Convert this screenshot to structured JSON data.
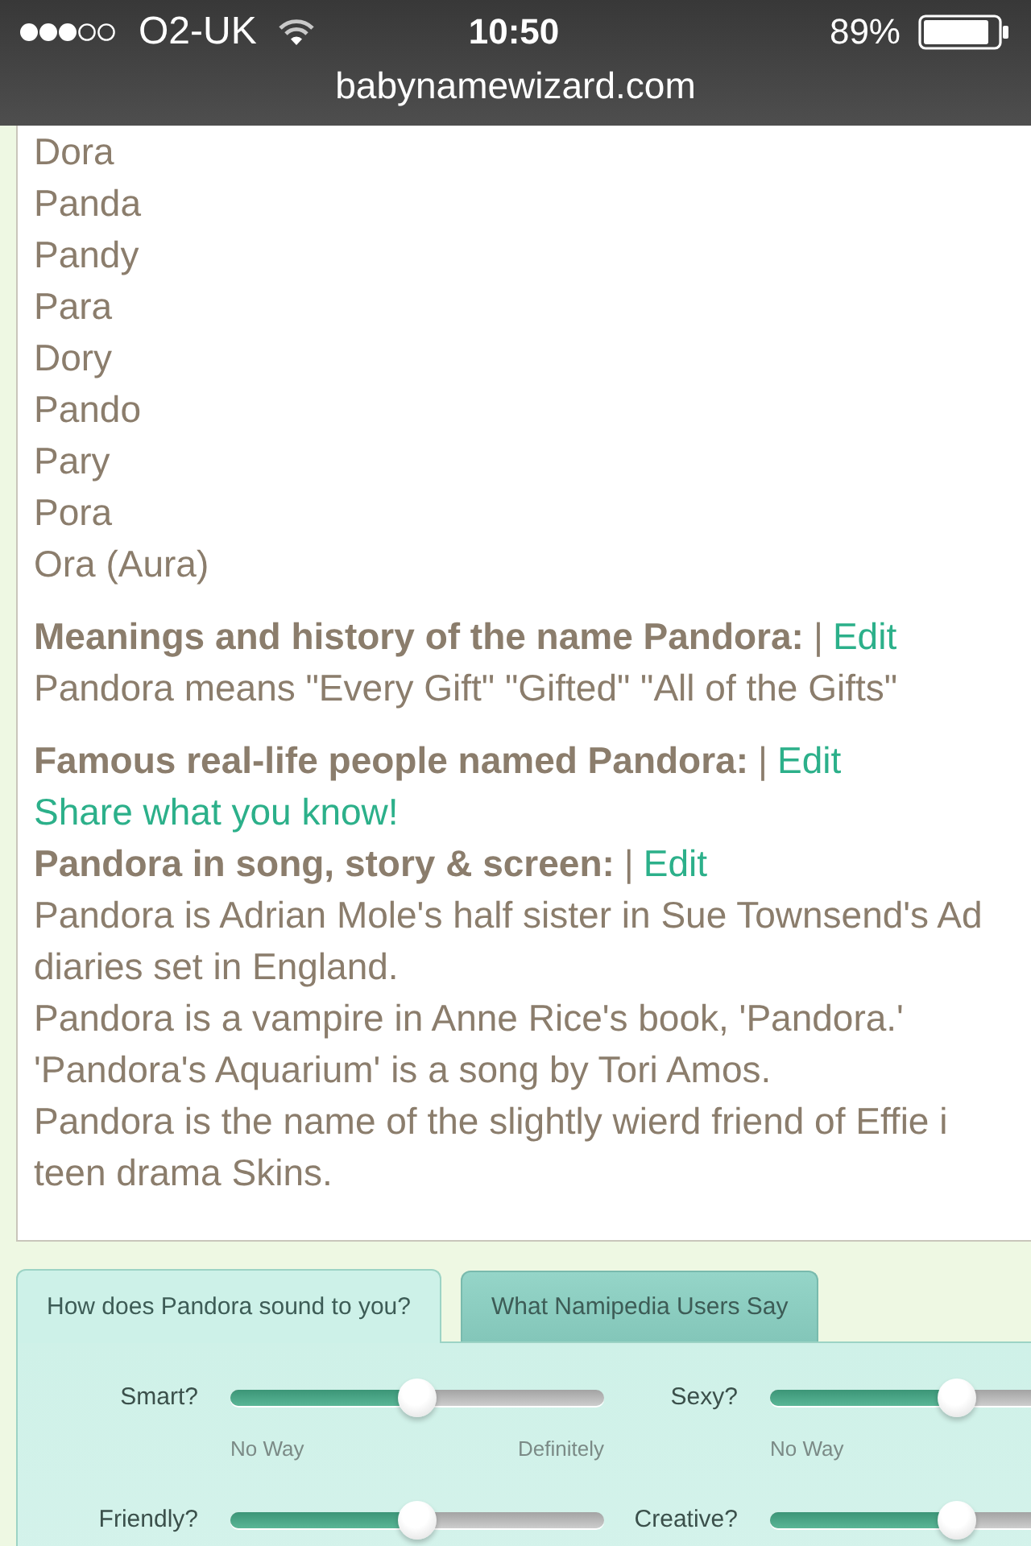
{
  "status_bar": {
    "carrier": "O2-UK",
    "time": "10:50",
    "battery": "89%",
    "url": "babynamewizard.com"
  },
  "nicknames": [
    "Dora",
    "Panda",
    "Pandy",
    "Para",
    "Dory",
    "Pando",
    "Pary",
    "Pora",
    "Ora (Aura)"
  ],
  "groups": [
    {
      "sections": [
        {
          "heading": "Meanings and history of the name Pandora:",
          "separator": "|",
          "link": "Edit",
          "body": [
            {
              "kind": "text",
              "lines": [
                "Pandora means \"Every Gift\" \"Gifted\" \"All of the Gifts\""
              ]
            }
          ]
        }
      ]
    },
    {
      "sections": [
        {
          "heading": "Famous real-life people named Pandora:",
          "separator": "|",
          "link": "Edit",
          "body": [
            {
              "kind": "link",
              "lines": [
                "Share what you know!"
              ]
            }
          ]
        },
        {
          "heading": "Pandora in song, story & screen:",
          "separator": "|",
          "link": "Edit",
          "body": [
            {
              "kind": "text",
              "lines": [
                "Pandora is Adrian Mole's half sister in Sue Townsend's Ad",
                "diaries set in England."
              ]
            },
            {
              "kind": "text",
              "lines": [
                "Pandora is a vampire in Anne Rice's book, 'Pandora.'"
              ]
            },
            {
              "kind": "text",
              "lines": [
                "'Pandora's Aquarium' is a song by Tori Amos."
              ]
            },
            {
              "kind": "text",
              "lines": [
                "Pandora is the name of the slightly wierd friend of Effie i",
                "teen drama Skins."
              ]
            }
          ]
        }
      ]
    }
  ],
  "rating_tabs": [
    {
      "label": "How does Pandora sound to you?",
      "selected": true
    },
    {
      "label": "What Namipedia Users Say",
      "selected": false
    }
  ],
  "sliders": [
    {
      "label": "Smart?",
      "level": 0.5,
      "low_label": "No Way",
      "high_label": "Definitely"
    },
    {
      "label": "Sexy?",
      "level": 0.5,
      "low_label": "No Way"
    },
    {
      "label": "Friendly?",
      "level": 0.5
    },
    {
      "label": "Creative?",
      "level": 0.5
    }
  ]
}
